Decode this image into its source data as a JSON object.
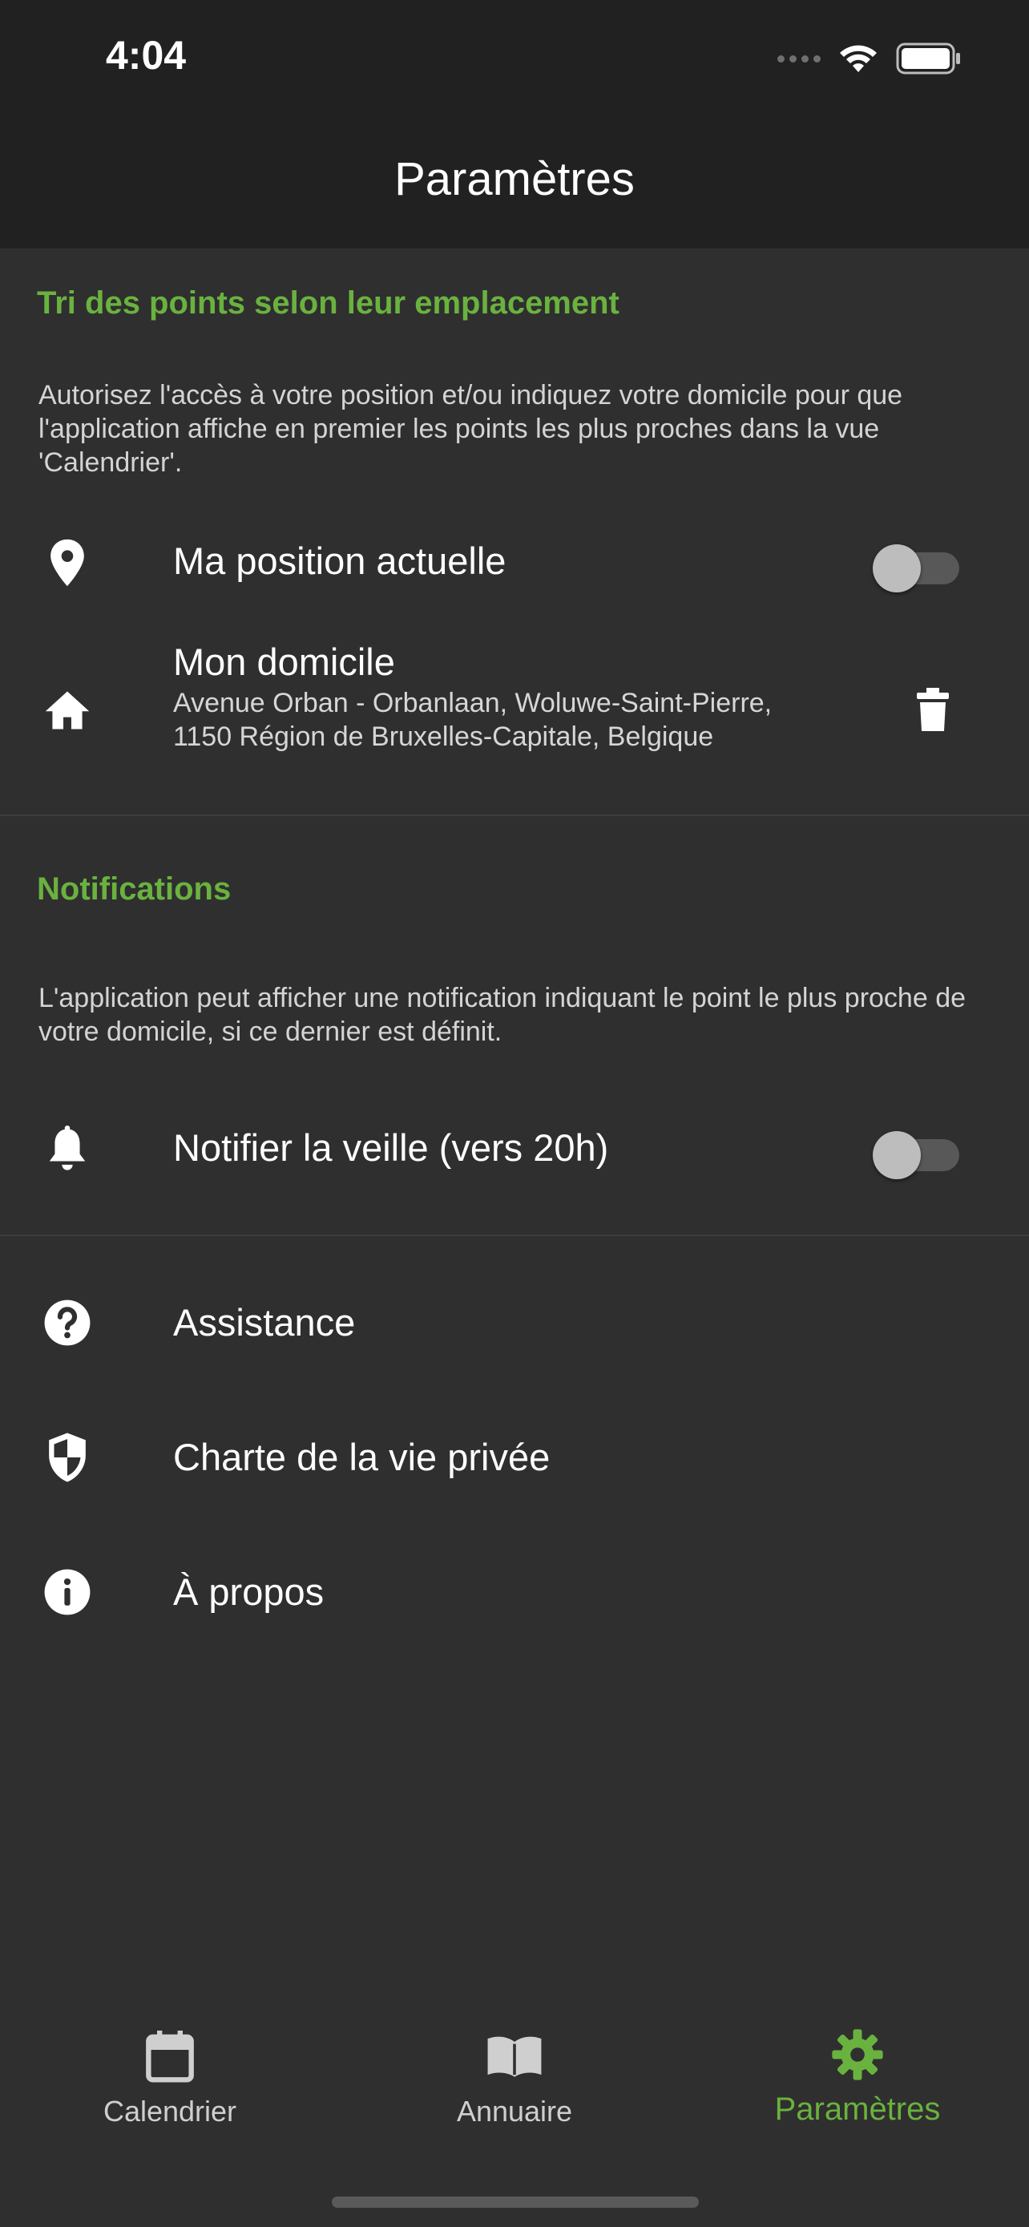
{
  "status": {
    "time": "4:04"
  },
  "header": {
    "title": "Paramètres"
  },
  "location_section": {
    "title": "Tri des points selon leur emplacement",
    "description": "Autorisez l'accès à votre position et/ou indiquez votre domicile pour que l'application affiche en premier les points les plus proches dans la vue 'Calendrier'.",
    "current_position": {
      "label": "Ma position actuelle",
      "enabled": false
    },
    "home": {
      "label": "Mon domicile",
      "address": "Avenue Orban - Orbanlaan, Woluwe-Saint-Pierre, 1150 Région de Bruxelles-Capitale, Belgique"
    }
  },
  "notifications_section": {
    "title": "Notifications",
    "description": "L'application peut afficher une notification indiquant le point le plus proche de votre domicile, si ce dernier est définit.",
    "notify": {
      "label": "Notifier la veille (vers 20h)",
      "enabled": false
    }
  },
  "links": [
    {
      "label": "Assistance",
      "icon": "help-circle-icon"
    },
    {
      "label": "Charte de la vie privée",
      "icon": "shield-icon"
    },
    {
      "label": "À propos",
      "icon": "info-icon"
    }
  ],
  "tabs": [
    {
      "label": "Calendrier",
      "icon": "calendar-icon",
      "active": false
    },
    {
      "label": "Annuaire",
      "icon": "book-icon",
      "active": false
    },
    {
      "label": "Paramètres",
      "icon": "gear-icon",
      "active": true
    }
  ],
  "colors": {
    "accent": "#6ab23f",
    "background": "#2f2f2f",
    "bar": "#212121"
  }
}
